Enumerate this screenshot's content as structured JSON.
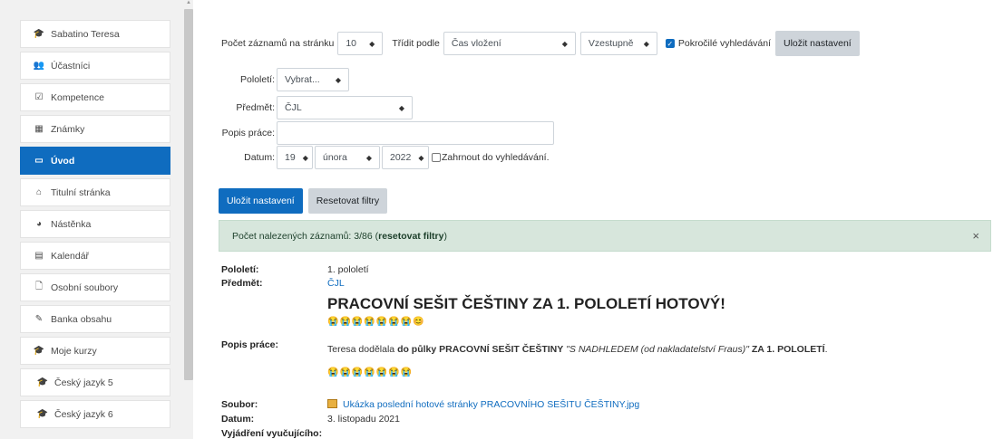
{
  "sidebar": {
    "items": [
      {
        "icon": "graduation-cap-icon",
        "glyph": "🎓",
        "label": "Sabatino Teresa"
      },
      {
        "icon": "users-icon",
        "glyph": "👥",
        "label": "Účastníci"
      },
      {
        "icon": "checkbox-icon",
        "glyph": "☑",
        "label": "Kompetence"
      },
      {
        "icon": "table-icon",
        "glyph": "▦",
        "label": "Známky"
      },
      {
        "icon": "folder-icon",
        "glyph": "▭",
        "label": "Úvod"
      },
      {
        "icon": "home-icon",
        "glyph": "⌂",
        "label": "Titulní stránka"
      },
      {
        "icon": "dashboard-icon",
        "glyph": "◕",
        "label": "Nástěnka"
      },
      {
        "icon": "calendar-icon",
        "glyph": "▤",
        "label": "Kalendář"
      },
      {
        "icon": "file-icon",
        "glyph": "🗋",
        "label": "Osobní soubory"
      },
      {
        "icon": "brush-icon",
        "glyph": "✎",
        "label": "Banka obsahu"
      },
      {
        "icon": "graduation-cap-icon",
        "glyph": "🎓",
        "label": "Moje kurzy"
      },
      {
        "icon": "graduation-cap-icon",
        "glyph": "🎓",
        "label": "Český jazyk 5"
      },
      {
        "icon": "graduation-cap-icon",
        "glyph": "🎓",
        "label": "Český jazyk 6"
      }
    ]
  },
  "toolbar": {
    "per_page_label": "Počet záznamů na stránku",
    "per_page_value": "10",
    "sort_label": "Třídit podle",
    "sort_value": "Čas vložení",
    "order_value": "Vzestupně",
    "advanced_label": "Pokročilé vyhledávání",
    "save_label": "Uložit nastavení"
  },
  "filters": {
    "term_label": "Pololetí:",
    "term_value": "Vybrat...",
    "subject_label": "Předmět:",
    "subject_value": "ČJL",
    "desc_label": "Popis práce:",
    "date_label": "Datum:",
    "day_value": "19",
    "month_value": "února",
    "year_value": "2022",
    "include_label": "Zahrnout do vyhledávání.",
    "save_label": "Uložit nastavení",
    "reset_label": "Resetovat filtry"
  },
  "alert": {
    "text_prefix": "Počet nalezených záznamů: 3/86 (",
    "link": "resetovat filtry",
    "text_suffix": ")",
    "close": "×"
  },
  "record": {
    "term_label": "Pololetí:",
    "term_value": "1. pololetí",
    "subject_label": "Předmět:",
    "subject_value": "ČJL",
    "title": "PRACOVNÍ SEŠIT ČEŠTINY ZA 1. POLOLETÍ HOTOVÝ!",
    "emojis_1": "😭😭😭😭😭😭😭😊",
    "desc_label": "Popis práce:",
    "desc_a": "Teresa dodělala ",
    "desc_b": "do půlky PRACOVNÍ SEŠIT ČEŠTINY",
    "desc_c": " \"S NADHLEDEM (od nakladatelství Fraus)\" ",
    "desc_d": "ZA 1. POLOLETÍ",
    "desc_e": ".",
    "emojis_2": "😭😭😭😭😭😭😭",
    "file_label": "Soubor:",
    "file_name": "Ukázka poslední hotové stránky PRACOVNÍHO SEŠITU ČEŠTINY.jpg",
    "date_label": "Datum:",
    "date_value": "3. listopadu 2021",
    "teacher_label": "Vyjádření vyučujícího:"
  },
  "colors": {
    "accent": "#0f6cbf",
    "alert_bg": "#d7e6dc"
  }
}
